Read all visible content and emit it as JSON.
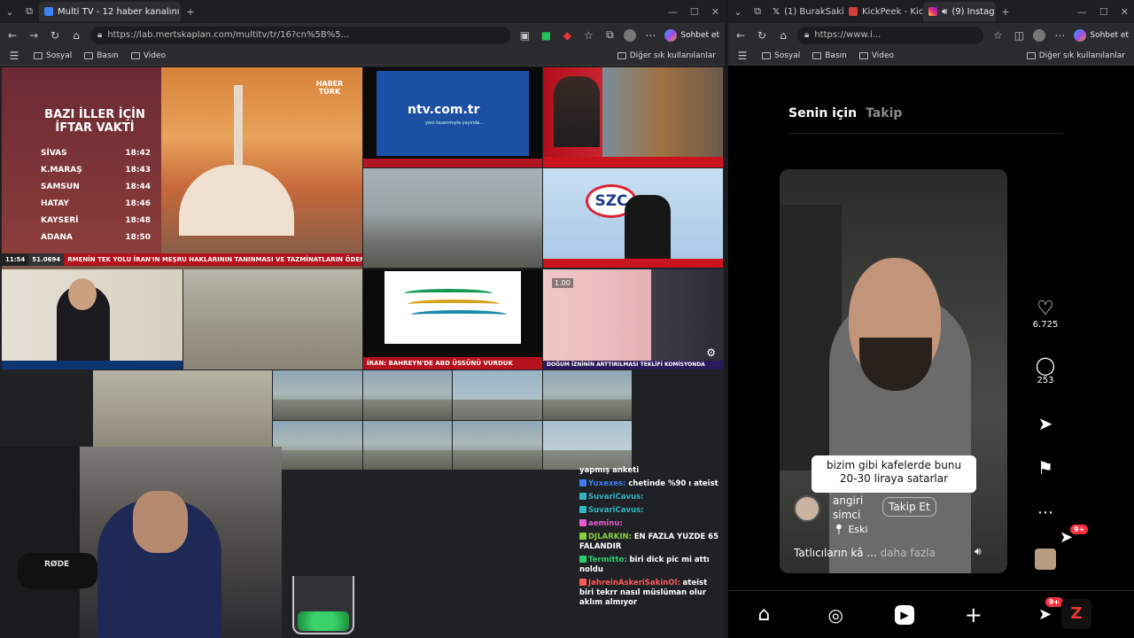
{
  "left_browser": {
    "tab_title": "Multi TV - 12 haber kanalını aynı a",
    "url": "https://lab.mertskaplan.com/multitv/tr/16?cn%5B%5...",
    "copilot_label": "Sohbet et",
    "bookmarks": [
      "Sosyal",
      "Basın",
      "Video"
    ],
    "bookmarks_right": "Diğer sık kullanılanlar"
  },
  "right_browser": {
    "tabs": [
      "(1) BurakSakin",
      "KickPeek - Kic",
      "(9) Instag"
    ],
    "url": "https://www.i...",
    "copilot_label": "Sohbet et",
    "bookmarks": [
      "Sosyal",
      "Basın",
      "Video"
    ],
    "bookmarks_right": "Diğer sık kullanılanlar"
  },
  "tv": {
    "iftar_title": "BAZI İLLER İÇİN İFTAR VAKTİ",
    "iftar_rows": [
      {
        "city": "SİVAS",
        "time": "18:42"
      },
      {
        "city": "K.MARAŞ",
        "time": "18:43"
      },
      {
        "city": "SAMSUN",
        "time": "18:44"
      },
      {
        "city": "HATAY",
        "time": "18:46"
      },
      {
        "city": "KAYSERİ",
        "time": "18:48"
      },
      {
        "city": "ADANA",
        "time": "18:50"
      }
    ],
    "haberturk_logo": "HABER TÜRK",
    "ticker_main": "RMENİN TEK YOLU İRAN'IN MEŞRU HAKLARININ TANINMASI VE TAZMİNATLARIN ÖDENM",
    "ticker_time": "11:54",
    "ticker_index": "51.0694",
    "ntv_logo": "ntv.com.tr",
    "ntv_sub": "yeni tasarımıyla yayında...",
    "szc_logo": "SZC",
    "ticker_iran": "İRAN: BAHREYN'DE ABD ÜSSÜNÜ VURDUK",
    "ticker_dogum": "DOĞUM İZNİNİN ARTTIRILMASI TEKLİFİ KOMİSYONDA",
    "speed": "1.00"
  },
  "chat": [
    {
      "user": "",
      "text": "yapmış anketi",
      "color": "#ffffff"
    },
    {
      "user": "Yuxexes:",
      "text": "chetinde %90 ı ateist",
      "color": "#3d7df5"
    },
    {
      "user": "SuvariCavus:",
      "text": "",
      "color": "#2fb6c6"
    },
    {
      "user": "SuvariCavus:",
      "text": "",
      "color": "#2fb6c6"
    },
    {
      "user": "aeminu:",
      "text": "",
      "color": "#e75bd1"
    },
    {
      "user": "DJLARKIN:",
      "text": "EN FAZLA YUZDE 65 FALANDIR",
      "color": "#8bd13a"
    },
    {
      "user": "Termitto:",
      "text": "biri dick pic mi attı noldu",
      "color": "#2ecc71"
    },
    {
      "user": "JahreinAskeriSakinOl:",
      "text": "ateist biri tekrr nasıl müslüman olur aklım almıyor",
      "color": "#ff5a5a"
    }
  ],
  "instagram": {
    "tab_for_you": "Senin için",
    "tab_following": "Takip",
    "caption_overlay": "bizim gibi kafelerde bunu 20-30 liraya satarlar",
    "username": "angiri simci",
    "follow_button": "Takip Et",
    "location": "Eski",
    "description": "Tatlıcıların kâ ...",
    "more": "daha fazla",
    "likes": "6.725",
    "comments": "253",
    "notification_badge": "9+",
    "nav_badge": "9+"
  },
  "watermark": "RØDE"
}
